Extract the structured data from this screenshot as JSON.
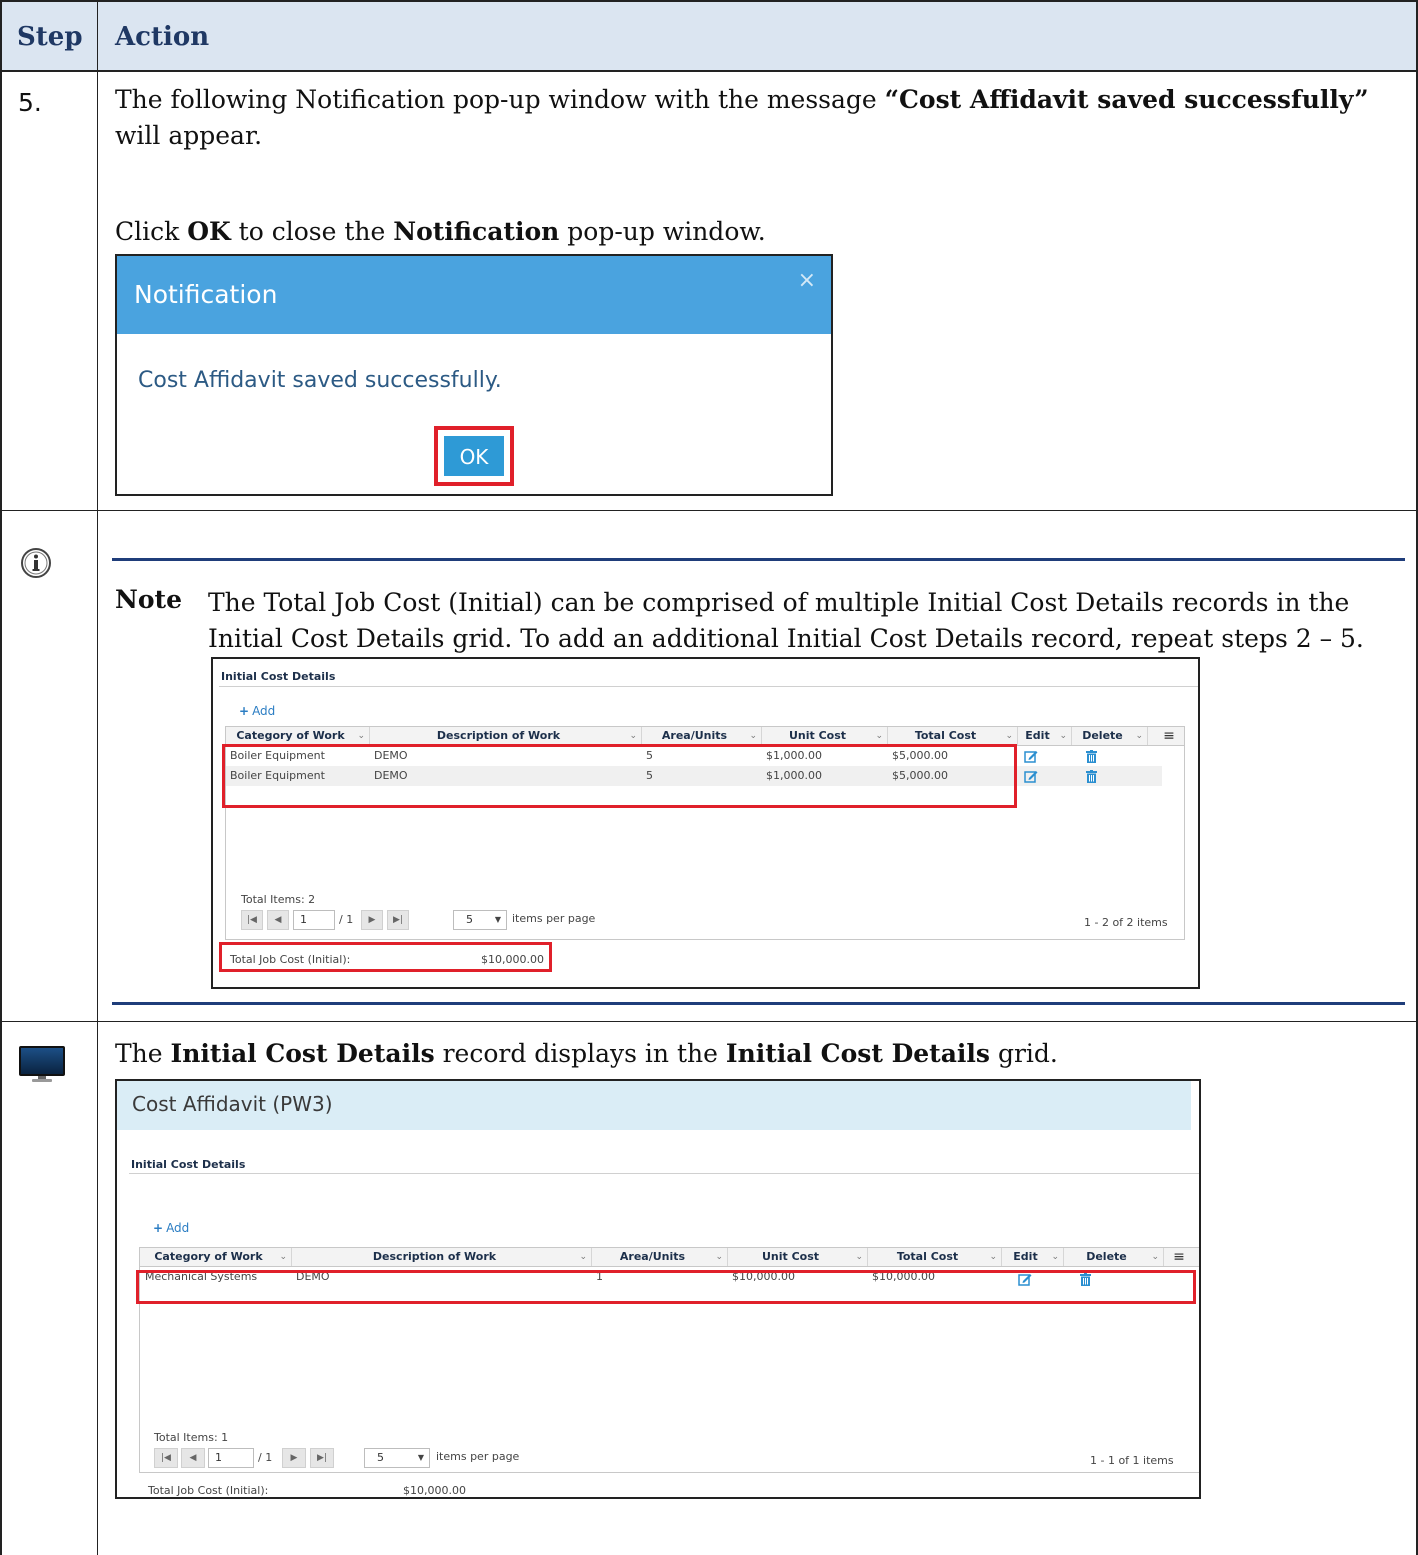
{
  "header": {
    "step": "Step",
    "action": "Action"
  },
  "step5": {
    "number": "5.",
    "line1_pre": "The following Notification pop-up window with the message ",
    "line1_bold": "“Cost Affidavit saved successfully”",
    "line2": "will appear.",
    "instr_pre": "Click ",
    "instr_ok": "OK",
    "instr_mid": " to close the ",
    "instr_notif": "Notification",
    "instr_post": " pop-up window."
  },
  "notification": {
    "title": "Notification",
    "close": "×",
    "message": "Cost Affidavit saved successfully.",
    "ok": "OK"
  },
  "note": {
    "label": "Note",
    "text": "The Total Job Cost (Initial) can be comprised of multiple Initial Cost Details records in the Initial Cost Details grid. To add an additional Initial Cost Details record, repeat steps 2 – 5."
  },
  "grid1": {
    "section_title": "Initial Cost Details",
    "add_label": "Add",
    "columns": [
      "Category of Work",
      "Description of Work",
      "Area/Units",
      "Unit Cost",
      "Total Cost",
      "Edit",
      "Delete"
    ],
    "rows": [
      [
        "Boiler Equipment",
        "DEMO",
        "5",
        "$1,000.00",
        "$5,000.00"
      ],
      [
        "Boiler Equipment",
        "DEMO",
        "5",
        "$1,000.00",
        "$5,000.00"
      ]
    ],
    "total_items": "Total Items: 2",
    "page": "1",
    "page_of": "/ 1",
    "per_page": "5",
    "per_page_label": "items per page",
    "range": "1 - 2 of 2 items",
    "total_label": "Total Job Cost (Initial):",
    "total_value": "$10,000.00"
  },
  "result": {
    "pre": "The ",
    "bold1": "Initial Cost Details",
    "mid": " record displays in the ",
    "bold2": "Initial Cost Details",
    "post": " grid."
  },
  "grid2": {
    "page_title": "Cost Affidavit (PW3)",
    "section_title": "Initial Cost Details",
    "add_label": "Add",
    "columns": [
      "Category of Work",
      "Description of Work",
      "Area/Units",
      "Unit Cost",
      "Total Cost",
      "Edit",
      "Delete"
    ],
    "rows": [
      [
        "Mechanical Systems",
        "DEMO",
        "1",
        "$10,000.00",
        "$10,000.00"
      ]
    ],
    "total_items": "Total Items: 1",
    "page": "1",
    "page_of": "/ 1",
    "per_page": "5",
    "per_page_label": "items per page",
    "range": "1 - 1 of 1 items",
    "total_label": "Total Job Cost (Initial):",
    "total_value": "$10,000.00"
  },
  "colors": {
    "accent": "#4aa3df",
    "highlight": "#e0202a",
    "header_bg": "#dbe5f1",
    "rule": "#1f3d7a"
  }
}
